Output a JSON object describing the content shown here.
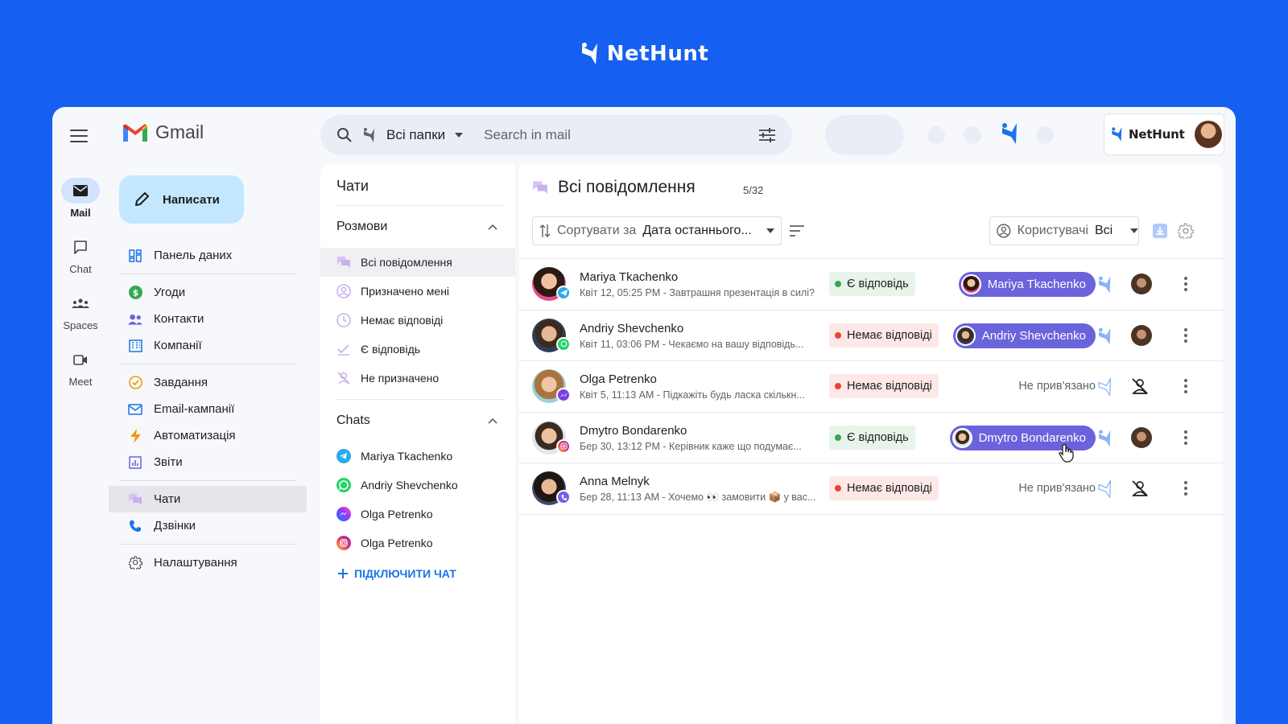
{
  "brand": {
    "name": "NetHunt",
    "color": "#1560f0"
  },
  "rail": {
    "items": [
      {
        "label": "Mail",
        "icon": "mail-icon"
      },
      {
        "label": "Chat",
        "icon": "chat-icon"
      },
      {
        "label": "Spaces",
        "icon": "spaces-icon"
      },
      {
        "label": "Meet",
        "icon": "meet-icon"
      }
    ]
  },
  "gmail": {
    "word": "Gmail"
  },
  "compose": {
    "label": "Написати"
  },
  "nav": {
    "dashboard": "Панель даних",
    "deals": "Угоди",
    "contacts": "Контакти",
    "companies": "Компанії",
    "tasks": "Завдання",
    "email_campaigns": "Email-кампанії",
    "automation": "Автоматизація",
    "reports": "Звіти",
    "chats": "Чати",
    "calls": "Дзвінки",
    "settings": "Налаштування"
  },
  "search": {
    "folders": "Всі папки",
    "placeholder": "Search in mail"
  },
  "badge": {
    "name": "NetHunt"
  },
  "chats_panel": {
    "title": "Чати",
    "conversations": {
      "heading": "Розмови",
      "items": [
        "Всі повідомлення",
        "Призначено мені",
        "Немає відповіді",
        "Є відповідь",
        "Не призначено"
      ]
    },
    "chats": {
      "heading": "Chats",
      "items": [
        "Mariya Tkachenko",
        "Andriy Shevchenko",
        "Olga Petrenko",
        "Olga Petrenko"
      ]
    },
    "connect": "ПІДКЛЮЧИТИ ЧАТ"
  },
  "main": {
    "title": "Всі повідомлення",
    "counter": "5/32",
    "sort_prefix": "Сортувати за",
    "sort_value": "Дата останнього...",
    "users_prefix": "Користувачі",
    "users_value": "Всі",
    "rows": [
      {
        "name": "Mariya Tkachenko",
        "sub": "Квіт 12, 05:25 PM - Завтрашня презентація в силі?",
        "status": "Є відповідь",
        "assignee": "Mariya Tkachenko",
        "channel": "telegram"
      },
      {
        "name": "Andriy Shevchenko",
        "sub": "Квіт 11, 03:06 PM - Чекаємо на вашу відповідь...",
        "status": "Немає відповіді",
        "assignee": "Andriy Shevchenko",
        "channel": "whatsapp"
      },
      {
        "name": "Olga Petrenko",
        "sub": "Квіт 5, 11:13 AM - Підкажіть будь ласка скількн...",
        "status": "Немає відповіді",
        "assignee": "Не прив'язано",
        "channel": "messenger"
      },
      {
        "name": "Dmytro Bondarenko",
        "sub": "Бер 30, 13:12 PM - Керівник каже що подумає...",
        "status": "Є відповідь",
        "assignee": "Dmytro Bondarenko",
        "channel": "instagram"
      },
      {
        "name": "Anna Melnyk",
        "sub": "Бер 28, 11:13 AM - Хочемо 👀 замовити 📦 у вас...",
        "status": "Немає відповіді",
        "assignee": "Не прив'язано",
        "channel": "viber"
      }
    ]
  }
}
